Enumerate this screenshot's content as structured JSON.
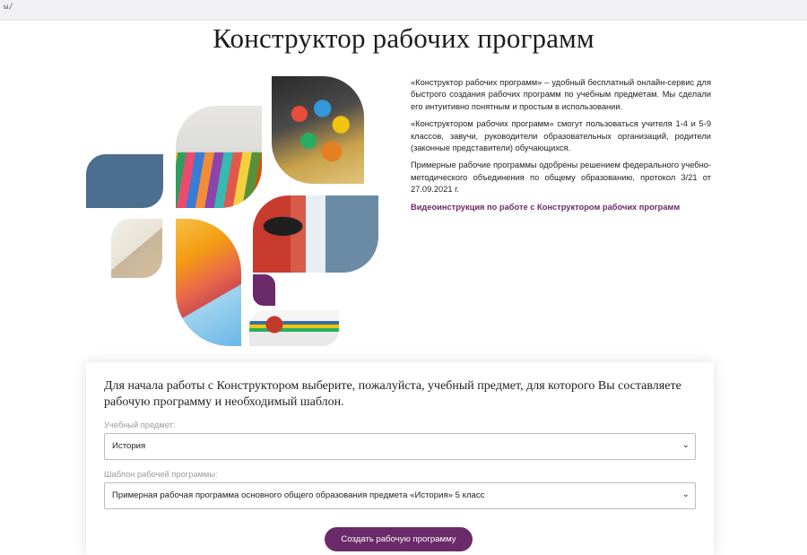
{
  "browser": {
    "crumb": "ы/"
  },
  "header": {
    "title": "Конструктор рабочих программ"
  },
  "description": {
    "paragraphs": [
      "«Конструктор рабочих программ» – удобный бесплатный онлайн-сервис для быстрого создания рабочих программ по учебным предметам. Мы сделали его интуитивно понятным и простым в использовании.",
      "«Конструктором рабочих программ» смогут пользоваться учителя 1-4 и 5-9 классов, завучи, руководители образовательных организаций, родители (законные представители) обучающихся.",
      "Примерные рабочие программы одобрены решением федерального учебно-методического объединения по общему образованию, протокол 3/21 от 27.09.2021 г."
    ],
    "video_link": "Видеоинструкция по работе с Конструктором рабочих программ"
  },
  "form": {
    "intro": "Для начала работы с Конструктором выберите, пожалуйста, учебный предмет, для которого Вы составляете рабочую программу и необходимый шаблон.",
    "subject": {
      "label": "Учебный предмет:",
      "value": "История"
    },
    "template": {
      "label": "Шаблон рабочей программы:",
      "value": "Примерная рабочая программа основного общего образования предмета «История» 5 класс"
    },
    "submit_label": "Создать рабочую программу"
  },
  "colors": {
    "accent": "#6b2a69",
    "tile_blue": "#4d6f8f"
  }
}
